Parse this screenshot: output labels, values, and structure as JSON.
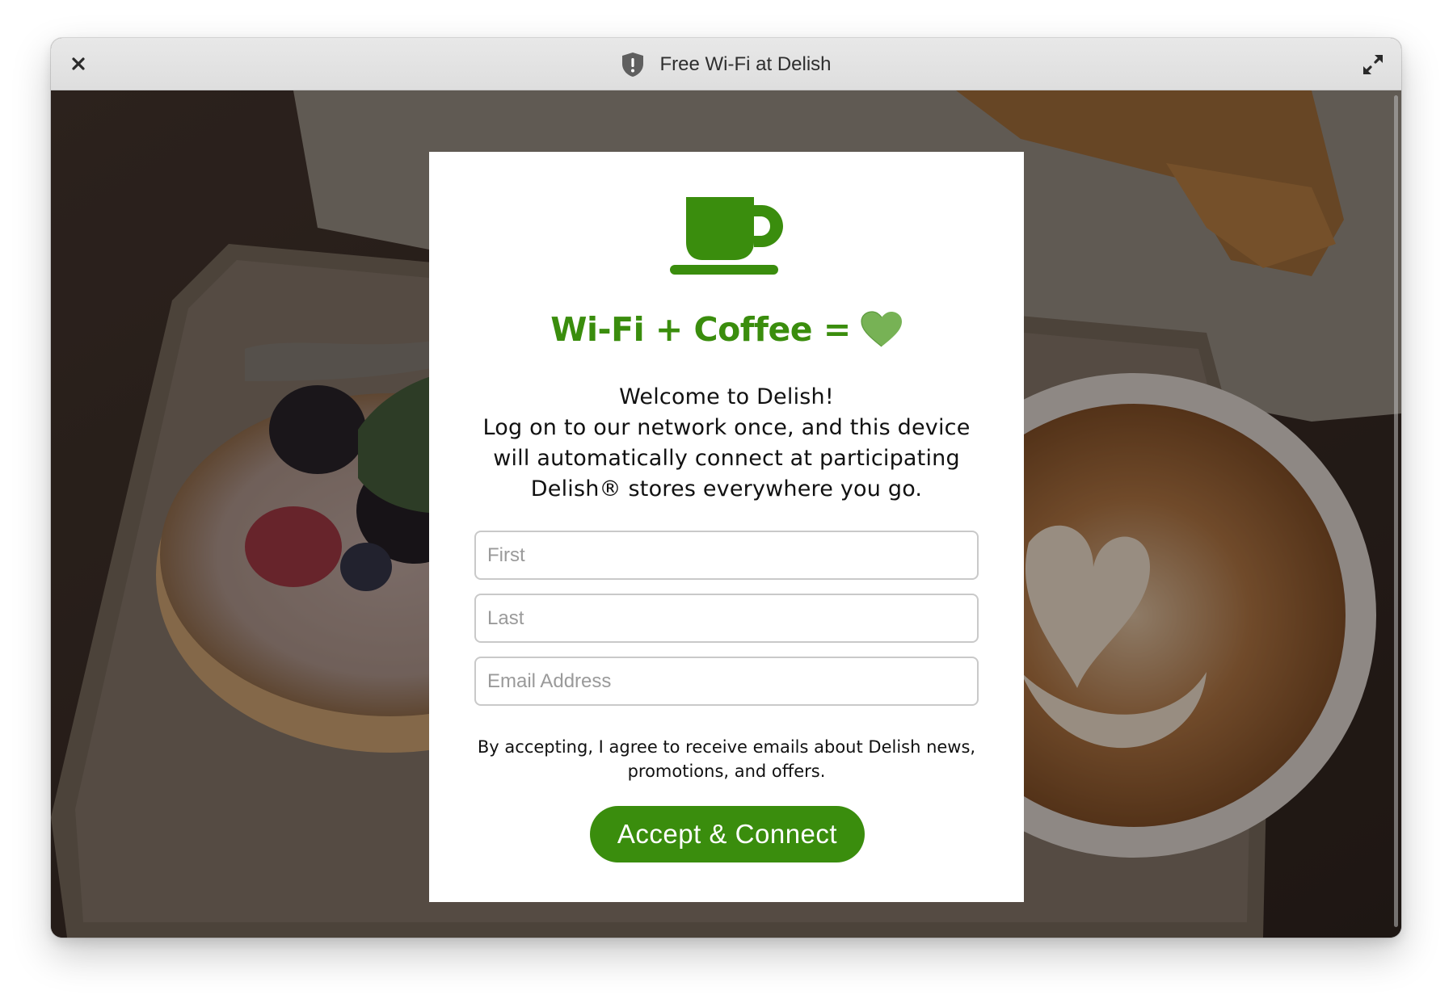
{
  "window": {
    "title": "Free Wi-Fi at Delish",
    "close_icon": "close-icon",
    "shield_icon": "shield-alert-icon",
    "expand_icon": "expand-icon"
  },
  "portal": {
    "logo_icon": "coffee-cup-icon",
    "headline": "Wi-Fi + Coffee = ",
    "headline_emoji": "green-heart-icon",
    "welcome_line": "Welcome to Delish!",
    "intro_line": "Log on to our network once, and this device will automatically connect at participating Delish® stores everywhere you go.",
    "fields": {
      "first_placeholder": "First",
      "last_placeholder": "Last",
      "email_placeholder": "Email Address"
    },
    "consent": "By accepting, I agree to receive emails about Delish news, promotions, and offers.",
    "accept_label": "Accept & Connect"
  },
  "colors": {
    "brand_green": "#3a8d0d",
    "heart_green": "#77b255"
  }
}
